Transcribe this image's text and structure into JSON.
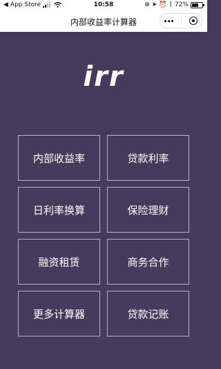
{
  "status_bar": {
    "carrier": "App Store",
    "time": "10:58",
    "battery_percent": "72%",
    "battery_level": 0.72
  },
  "header": {
    "title": "内部收益率计算器"
  },
  "logo": {
    "text": "irr"
  },
  "menu": {
    "items": [
      {
        "label": "内部收益率"
      },
      {
        "label": "贷款利率"
      },
      {
        "label": "日利率换算"
      },
      {
        "label": "保险理财"
      },
      {
        "label": "融资租赁"
      },
      {
        "label": "商务合作"
      },
      {
        "label": "更多计算器"
      },
      {
        "label": "贷款记账"
      }
    ]
  },
  "colors": {
    "background": "#453b5c",
    "tile_border": "#b8b2c8",
    "text": "#ffffff"
  }
}
